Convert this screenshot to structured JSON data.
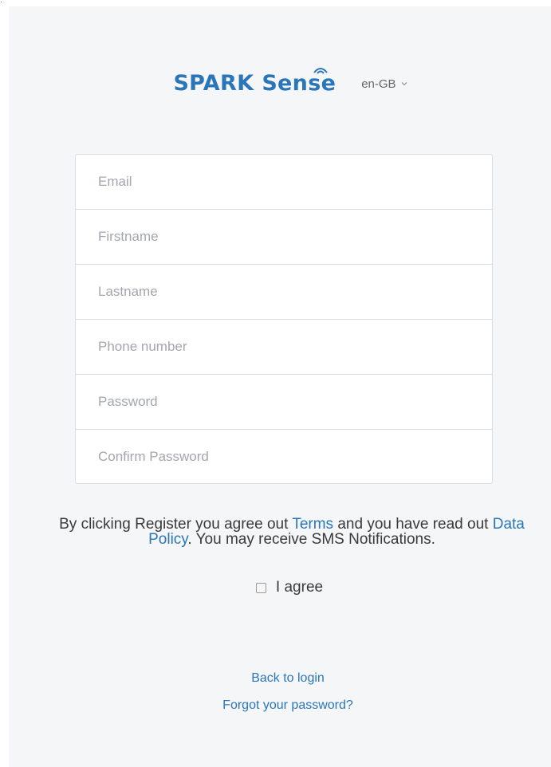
{
  "header": {
    "logo_word1": "SPARK",
    "logo_word2": "Sense",
    "language": "en-GB"
  },
  "form": {
    "fields": [
      {
        "placeholder": "Email",
        "value": ""
      },
      {
        "placeholder": "Firstname",
        "value": ""
      },
      {
        "placeholder": "Lastname",
        "value": ""
      },
      {
        "placeholder": "Phone number",
        "value": ""
      },
      {
        "placeholder": "Password",
        "value": ""
      },
      {
        "placeholder": "Confirm Password",
        "value": ""
      }
    ]
  },
  "terms": {
    "text_before": "By clicking Register you agree out ",
    "terms_link": "Terms",
    "text_middle": " and you have read out ",
    "policy_link": "Data Policy",
    "text_after": ". You may receive SMS Notifications."
  },
  "agree": {
    "label": "I agree",
    "checked": false
  },
  "links": {
    "back_to_login": "Back to login",
    "forgot_password": "Forgot your password?"
  },
  "colors": {
    "brand": "#2a76b8",
    "background": "#f5f6f8",
    "border": "#d9dde3"
  },
  "icons": {
    "language_dropdown": "chevron-down-icon",
    "logo_wave": "signal-wave-icon"
  }
}
